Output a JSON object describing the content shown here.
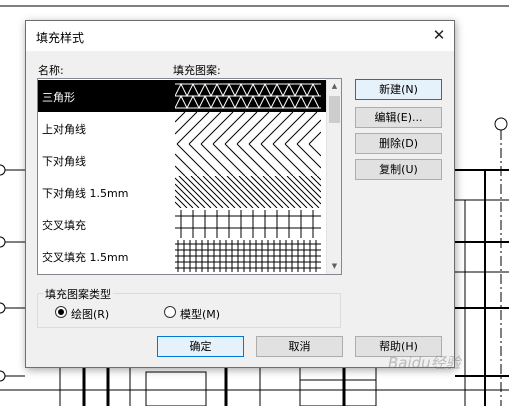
{
  "dialog": {
    "title": "填充样式",
    "name_header": "名称:",
    "pattern_header": "填充图案:",
    "patterns": [
      {
        "name": "三角形",
        "pattern": "triangle",
        "selected": true
      },
      {
        "name": "上对角线",
        "pattern": "diag-up",
        "selected": false
      },
      {
        "name": "下对角线",
        "pattern": "diag-down",
        "selected": false
      },
      {
        "name": "下对角线 1.5mm",
        "pattern": "diag-down-fine",
        "selected": false
      },
      {
        "name": "交叉填充",
        "pattern": "cross",
        "selected": false
      },
      {
        "name": "交叉填充 1.5mm",
        "pattern": "cross-fine",
        "selected": false
      }
    ],
    "buttons": {
      "new": "新建(N)",
      "edit": "编辑(E)...",
      "delete": "删除(D)",
      "copy": "复制(U)",
      "ok": "确定",
      "cancel": "取消",
      "help": "帮助(H)"
    },
    "type_group": {
      "title": "填充图案类型",
      "drafting": "绘图(R)",
      "model": "模型(M)",
      "selected": "drafting"
    }
  },
  "watermark": "Baidu经验",
  "colors": {
    "selection": "#000000",
    "default_button_border": "#0078d7",
    "dialog_bg": "#f0f0f0"
  }
}
